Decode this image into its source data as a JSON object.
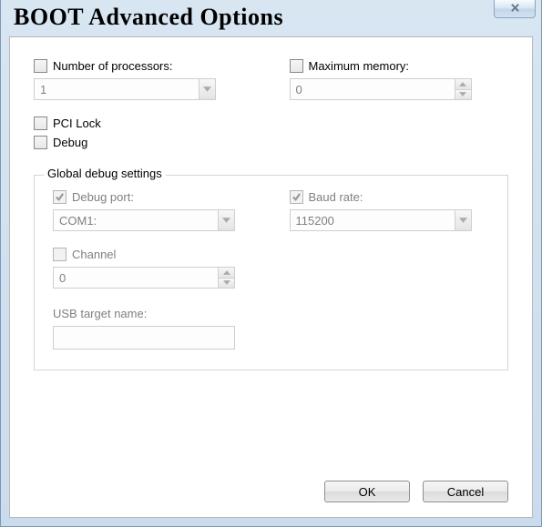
{
  "title": "BOOT Advanced Options",
  "processors": {
    "checkbox_label": "Number of processors:",
    "checked": false,
    "value": "1"
  },
  "max_memory": {
    "checkbox_label": "Maximum memory:",
    "checked": false,
    "value": "0"
  },
  "pci_lock": {
    "label": "PCI Lock",
    "checked": false
  },
  "debug": {
    "label": "Debug",
    "checked": false
  },
  "global_debug": {
    "legend": "Global debug settings",
    "debug_port": {
      "label": "Debug port:",
      "checked": true,
      "value": "COM1:"
    },
    "baud_rate": {
      "label": "Baud rate:",
      "checked": true,
      "value": "115200"
    },
    "channel": {
      "label": "Channel",
      "checked": false,
      "value": "0"
    },
    "usb_target_label": "USB target name:",
    "usb_target_value": ""
  },
  "buttons": {
    "ok": "OK",
    "cancel": "Cancel"
  }
}
